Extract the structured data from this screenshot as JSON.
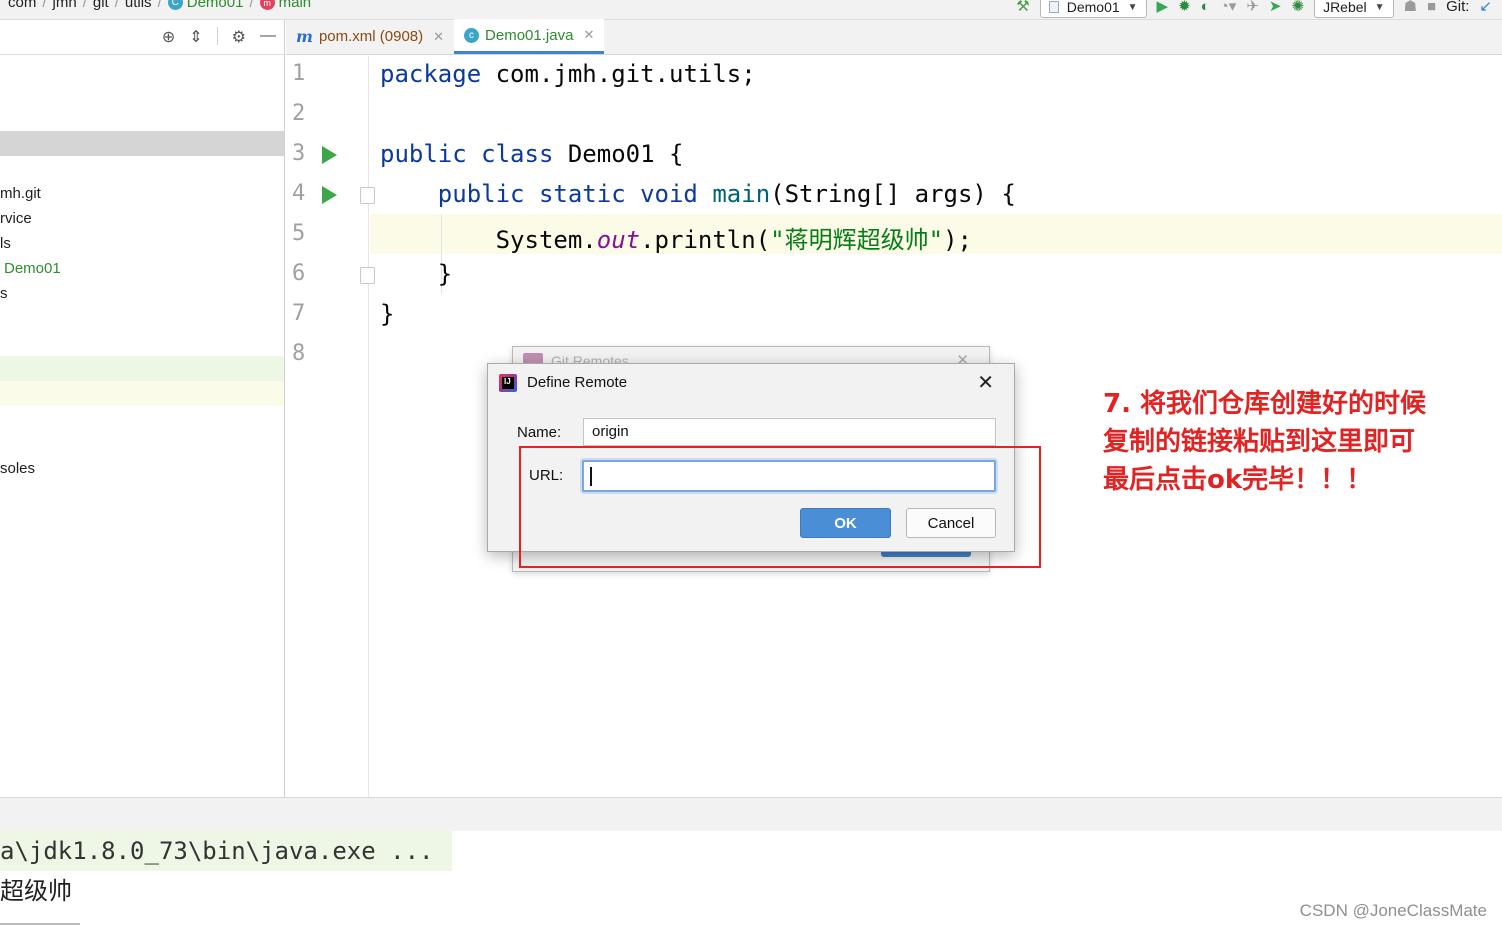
{
  "breadcrumb": {
    "items": [
      "com",
      "jmh",
      "git",
      "utils",
      "Demo01",
      "main"
    ]
  },
  "toolbar": {
    "run_config": "Demo01",
    "jrebel": "JRebel",
    "git": "Git:"
  },
  "sidebar": {
    "rows": [
      "mh.git",
      "rvice",
      "ls",
      "Demo01",
      "s",
      "soles"
    ]
  },
  "tabs": [
    {
      "label": "pom.xml (0908)",
      "icon": "m"
    },
    {
      "label": "Demo01.java",
      "icon": "c"
    }
  ],
  "editor": {
    "line_numbers": [
      "1",
      "2",
      "3",
      "4",
      "5",
      "6",
      "7",
      "8"
    ],
    "code": {
      "l1_kw": "package",
      "l1_rest": " com.jmh.git.utils;",
      "l3_kw": "public class",
      "l3_rest": " Demo01 {",
      "l4_indent": "    ",
      "l4_kw": "public static void",
      "l4_sp": " ",
      "l4_fn": "main",
      "l4_rest": "(String[] args) {",
      "l5_indent": "        ",
      "l5_a": "System.",
      "l5_field": "out",
      "l5_b": ".println(",
      "l5_str": "\"蒋明辉超级帅\"",
      "l5_c": ");",
      "l6": "    }",
      "l7": "}"
    }
  },
  "console": {
    "line1": "a\\jdk1.8.0_73\\bin\\java.exe ...",
    "line2": "超级帅"
  },
  "bg_dialog": {
    "title": "Git Remotes"
  },
  "dialog": {
    "title": "Define Remote",
    "name_label": "Name:",
    "name_value": "origin",
    "url_label": "URL:",
    "url_value": "",
    "ok_label": "OK",
    "cancel_label": "Cancel"
  },
  "annotation": {
    "line1": "7. 将我们仓库创建好的时候",
    "line2": "复制的链接粘贴到这里即可",
    "line3": "最后点击ok完毕！！！",
    "color": "#e02424"
  },
  "watermark": "CSDN @JoneClassMate"
}
